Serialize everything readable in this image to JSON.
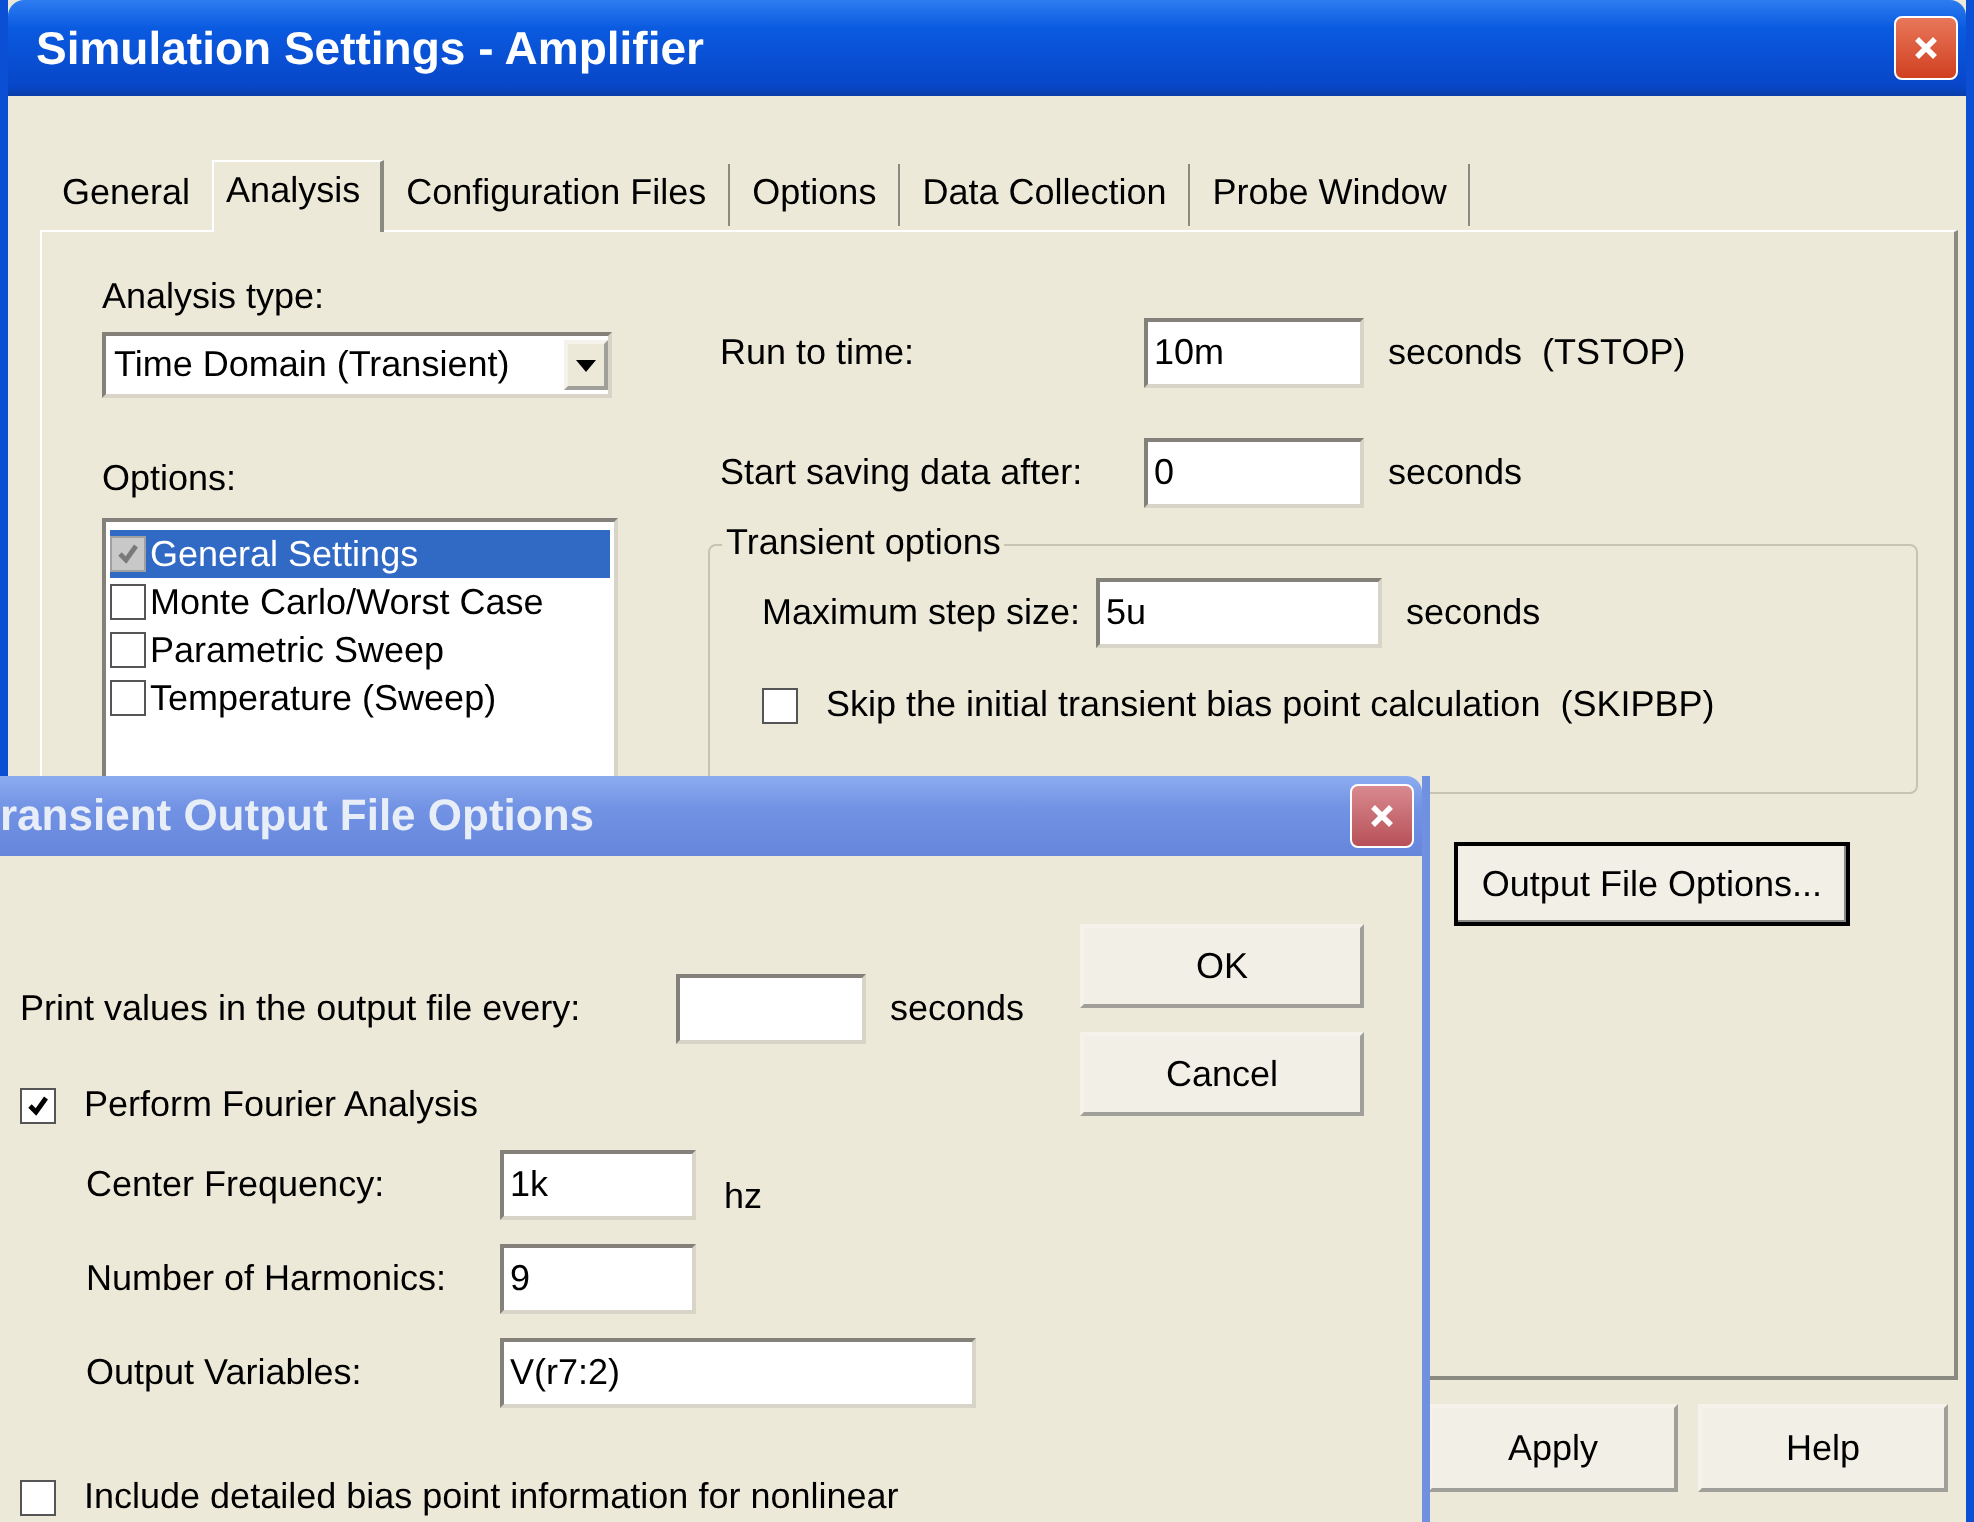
{
  "window": {
    "title": "Simulation Settings - Amplifier"
  },
  "tabs": [
    {
      "label": "General",
      "selected": false
    },
    {
      "label": "Analysis",
      "selected": true
    },
    {
      "label": "Configuration Files",
      "selected": false
    },
    {
      "label": "Options",
      "selected": false
    },
    {
      "label": "Data Collection",
      "selected": false
    },
    {
      "label": "Probe Window",
      "selected": false
    }
  ],
  "analysis_type": {
    "label": "Analysis type:",
    "value": "Time Domain (Transient)"
  },
  "options": {
    "label": "Options:",
    "items": [
      {
        "label": "General Settings",
        "checked": true,
        "disabled": true,
        "selected": true
      },
      {
        "label": "Monte Carlo/Worst Case",
        "checked": false,
        "disabled": false,
        "selected": false
      },
      {
        "label": "Parametric Sweep",
        "checked": false,
        "disabled": false,
        "selected": false
      },
      {
        "label": "Temperature (Sweep)",
        "checked": false,
        "disabled": false,
        "selected": false
      }
    ]
  },
  "fields": [
    {
      "label": "Run to time:",
      "value": "10m",
      "unit": "seconds  (TSTOP)"
    },
    {
      "label": "Start saving data after:",
      "value": "0",
      "unit": "seconds"
    }
  ],
  "transient_options": {
    "title": "Transient options",
    "max_step": {
      "label": "Maximum step size:",
      "value": "5u",
      "unit": "seconds"
    },
    "skip_bias": {
      "label": "Skip the initial transient bias point calculation  (SKIPBP)",
      "checked": false
    }
  },
  "output_file_button": "Output File Options...",
  "buttons": [
    "Apply",
    "Help"
  ],
  "dialog": {
    "title": "ransient Output File Options",
    "print_every": {
      "label": "Print values in the output file every:",
      "unit": "seconds"
    },
    "buttons": [
      "OK",
      "Cancel"
    ],
    "fourier": {
      "label": "Perform Fourier Analysis",
      "checked": true
    },
    "fourier_fields": [
      {
        "label": "Center Frequency:",
        "value": "1k",
        "unit": "hz"
      },
      {
        "label": "Number of Harmonics:",
        "value": "9"
      },
      {
        "label": "Output Variables:",
        "value": "V(r7:2)"
      }
    ],
    "bias_info": {
      "label": "Include detailed bias point information for nonlinear",
      "checked": false
    }
  }
}
